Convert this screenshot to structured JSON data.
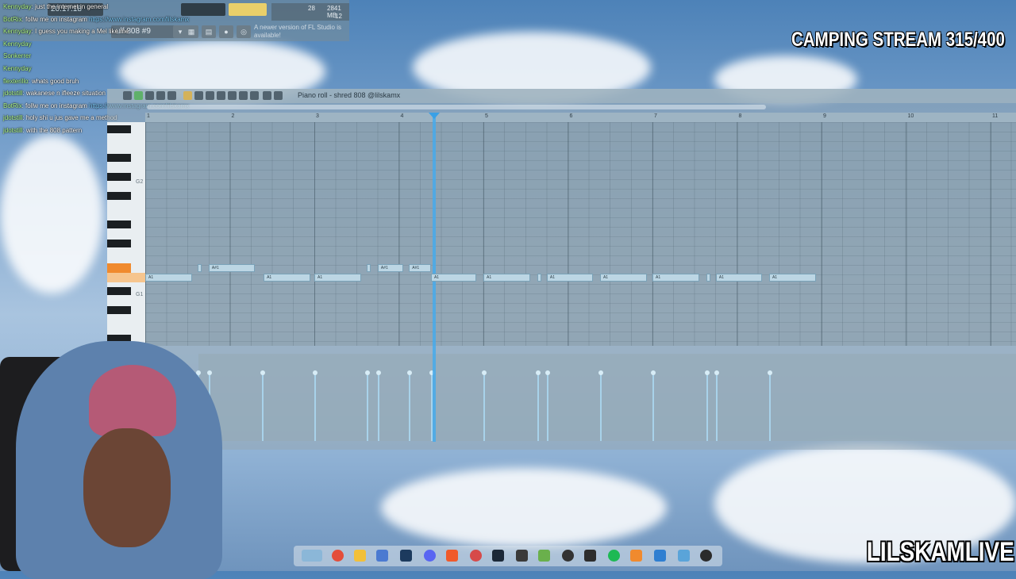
{
  "stream": {
    "title": "CAMPING STREAM 315/400",
    "channel": "LILSKAMLIVE"
  },
  "fl_toolbar": {
    "pattern_name": "ulf 808 #9",
    "update_hint": "A newer version of FL Studio is available!",
    "cpu": "28",
    "ram": "2841 MB",
    "poly": "12",
    "tempo_display": "20:17:18"
  },
  "chat": [
    {
      "user": "Kennyday",
      "text": ": just the internet in general"
    },
    {
      "user": "BotRix",
      "text": ": follw me on instagram",
      "link": "https://www.instagram.com/lilskamx"
    },
    {
      "user": "Kennyday",
      "text": ": I guess you making a Mel like me"
    },
    {
      "user": "Kennyday",
      "text": ""
    },
    {
      "user": "Sonkerrer",
      "text": ""
    },
    {
      "user": "Kennyday",
      "text": ""
    },
    {
      "user": "flexterillo",
      "text": ": whats good bruh"
    },
    {
      "user": "jdotstill",
      "text": ": wakanese n ifleeze situation"
    },
    {
      "user": "BotRix",
      "text": ": follw me on instagram",
      "link": "https://www.instagram.com/lilskamx"
    },
    {
      "user": "jdotstill",
      "text": ": holy shi u jus gave me a method"
    },
    {
      "user": "jdotstill",
      "text": ": with the 808 pattern"
    }
  ],
  "piano_roll": {
    "title": "Piano roll - shred 808 @lilskamx",
    "bars": [
      "1",
      "2",
      "3",
      "4",
      "5",
      "6",
      "7",
      "8",
      "9",
      "10",
      "11"
    ],
    "octave_labels": [
      "G2",
      "G1"
    ],
    "notes_low": [
      {
        "label": "A1",
        "start": 1.0,
        "end": 1.55
      },
      {
        "label": "A1",
        "start": 2.4,
        "end": 2.95
      },
      {
        "label": "A1",
        "start": 3.0,
        "end": 3.55
      },
      {
        "label": "A1",
        "start": 4.38,
        "end": 4.92
      },
      {
        "label": "A1",
        "start": 5.0,
        "end": 5.55
      },
      {
        "label": "A1",
        "start": 5.64,
        "end": 5.68
      },
      {
        "label": "A1",
        "start": 5.75,
        "end": 6.3
      },
      {
        "label": "A1",
        "start": 6.38,
        "end": 6.93
      },
      {
        "label": "A1",
        "start": 7.0,
        "end": 7.55
      },
      {
        "label": "A1",
        "start": 7.64,
        "end": 7.68
      },
      {
        "label": "A1",
        "start": 7.75,
        "end": 8.3
      },
      {
        "label": "A1",
        "start": 8.38,
        "end": 8.93
      }
    ],
    "notes_high": [
      {
        "label": "A#1",
        "start": 1.62,
        "end": 1.66
      },
      {
        "label": "A#1",
        "start": 1.75,
        "end": 2.3
      },
      {
        "label": "A#1",
        "start": 3.62,
        "end": 3.66
      },
      {
        "label": "A#1",
        "start": 3.75,
        "end": 4.05
      },
      {
        "label": "A#1",
        "start": 4.12,
        "end": 4.38
      }
    ],
    "velocity_positions": [
      1.62,
      1.75,
      2.38,
      3.0,
      3.62,
      3.75,
      4.12,
      4.38,
      5.0,
      5.64,
      5.75,
      6.38,
      7.0,
      7.64,
      7.75,
      8.38
    ]
  }
}
